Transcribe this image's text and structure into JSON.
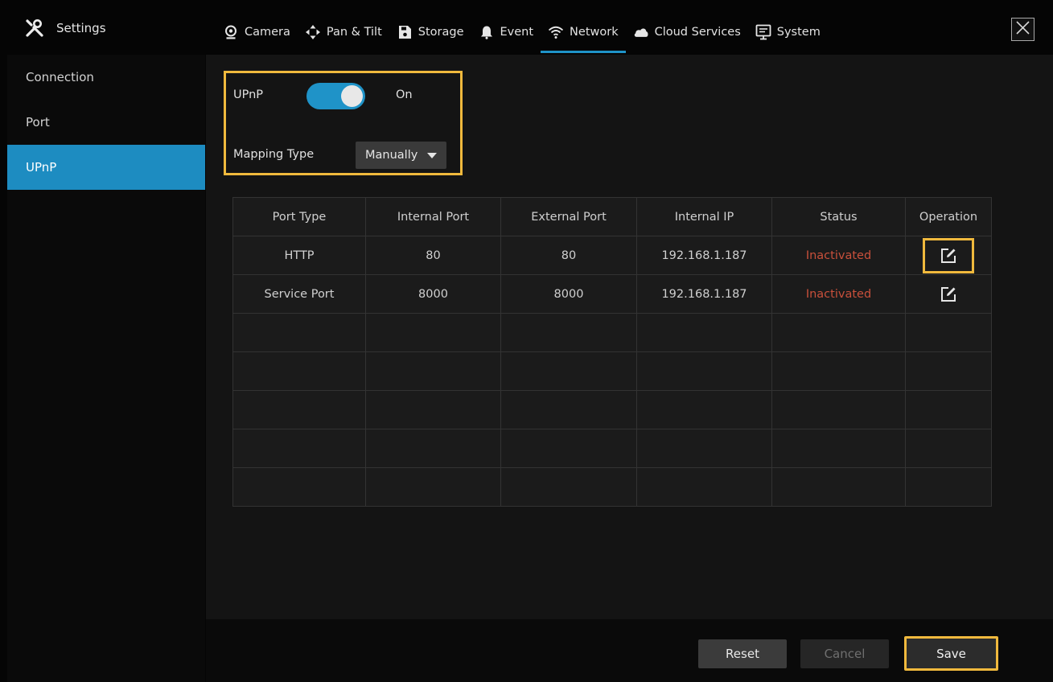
{
  "header": {
    "title": "Settings",
    "tabs": [
      {
        "label": "Camera",
        "icon": "camera-icon"
      },
      {
        "label": "Pan & Tilt",
        "icon": "pan-tilt-icon"
      },
      {
        "label": "Storage",
        "icon": "storage-icon"
      },
      {
        "label": "Event",
        "icon": "bell-icon"
      },
      {
        "label": "Network",
        "icon": "wifi-icon",
        "active": true
      },
      {
        "label": "Cloud Services",
        "icon": "cloud-icon"
      },
      {
        "label": "System",
        "icon": "monitor-icon"
      }
    ]
  },
  "sidebar": {
    "items": [
      {
        "label": "Connection"
      },
      {
        "label": "Port"
      },
      {
        "label": "UPnP",
        "active": true
      }
    ]
  },
  "upnp": {
    "label": "UPnP",
    "state": "On",
    "mapping_label": "Mapping Type",
    "mapping_value": "Manually"
  },
  "table": {
    "headers": [
      "Port Type",
      "Internal Port",
      "External Port",
      "Internal IP",
      "Status",
      "Operation"
    ],
    "rows": [
      {
        "port_type": "HTTP",
        "internal_port": "80",
        "external_port": "80",
        "internal_ip": "192.168.1.187",
        "status": "Inactivated"
      },
      {
        "port_type": "Service Port",
        "internal_port": "8000",
        "external_port": "8000",
        "internal_ip": "192.168.1.187",
        "status": "Inactivated"
      }
    ]
  },
  "buttons": {
    "reset": "Reset",
    "cancel": "Cancel",
    "save": "Save"
  },
  "colors": {
    "accent": "#1f93c8",
    "highlight": "#f0b93d",
    "status_inactive": "#c9503b"
  }
}
